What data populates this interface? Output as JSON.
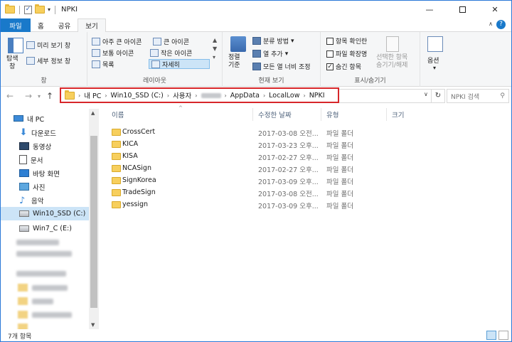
{
  "window": {
    "title": "NPKI",
    "minimize": "—",
    "close": "✕"
  },
  "tabs": {
    "file": "파일",
    "home": "홈",
    "share": "공유",
    "view": "보기"
  },
  "ribbon": {
    "panes": {
      "nav_pane": "탐색\n창",
      "preview": "미리 보기 창",
      "details": "세부 정보 창",
      "label": "창"
    },
    "layout": {
      "xl": "아주 큰 아이콘",
      "large": "큰 아이콘",
      "medium": "보통 아이콘",
      "small": "작은 아이콘",
      "list": "목록",
      "details": "자세히",
      "label": "레이아웃"
    },
    "current_view": {
      "sort": "정렬\n기준",
      "group": "분류 방법",
      "add_col": "열 추가",
      "fit_cols": "모든 열 너비 조정",
      "label": "현재 보기"
    },
    "show_hide": {
      "item_checkboxes": "항목 확인란",
      "extensions": "파일 확장명",
      "hidden_items": "숨긴 항목",
      "hide_selected": "선택한 항목\n숨기기/해제",
      "label": "표시/숨기기"
    },
    "options": "옵션"
  },
  "address": {
    "segments": [
      "내 PC",
      "Win10_SSD (C:)",
      "사용자",
      "",
      "AppData",
      "LocalLow",
      "NPKI"
    ],
    "search_placeholder": "NPKI 검색"
  },
  "nav": {
    "items": [
      {
        "label": "내 PC",
        "icon": "pc-icon"
      },
      {
        "label": "다운로드",
        "icon": "download-icon"
      },
      {
        "label": "동영상",
        "icon": "video-icon"
      },
      {
        "label": "문서",
        "icon": "document-icon"
      },
      {
        "label": "바탕 화면",
        "icon": "desktop-icon"
      },
      {
        "label": "사진",
        "icon": "pictures-icon"
      },
      {
        "label": "음악",
        "icon": "music-icon"
      },
      {
        "label": "Win10_SSD (C:)",
        "icon": "drive-icon",
        "selected": true
      },
      {
        "label": "Win7_C (E:)",
        "icon": "drive-icon"
      }
    ]
  },
  "columns": {
    "name": "이름",
    "modified": "수정한 날짜",
    "type": "유형",
    "size": "크기"
  },
  "files": [
    {
      "name": "CrossCert",
      "date": "2017-03-08 오전...",
      "type": "파일 폴더"
    },
    {
      "name": "KICA",
      "date": "2017-03-23 오후...",
      "type": "파일 폴더"
    },
    {
      "name": "KISA",
      "date": "2017-02-27 오후...",
      "type": "파일 폴더"
    },
    {
      "name": "NCASign",
      "date": "2017-02-27 오후...",
      "type": "파일 폴더"
    },
    {
      "name": "SignKorea",
      "date": "2017-03-09 오후...",
      "type": "파일 폴더"
    },
    {
      "name": "TradeSign",
      "date": "2017-03-08 오전...",
      "type": "파일 폴더"
    },
    {
      "name": "yessign",
      "date": "2017-03-09 오후...",
      "type": "파일 폴더"
    }
  ],
  "status": {
    "count": "7개 항목"
  },
  "colors": {
    "accent": "#1979ca",
    "highlight": "#d7272a",
    "selection": "#cce4f7"
  }
}
